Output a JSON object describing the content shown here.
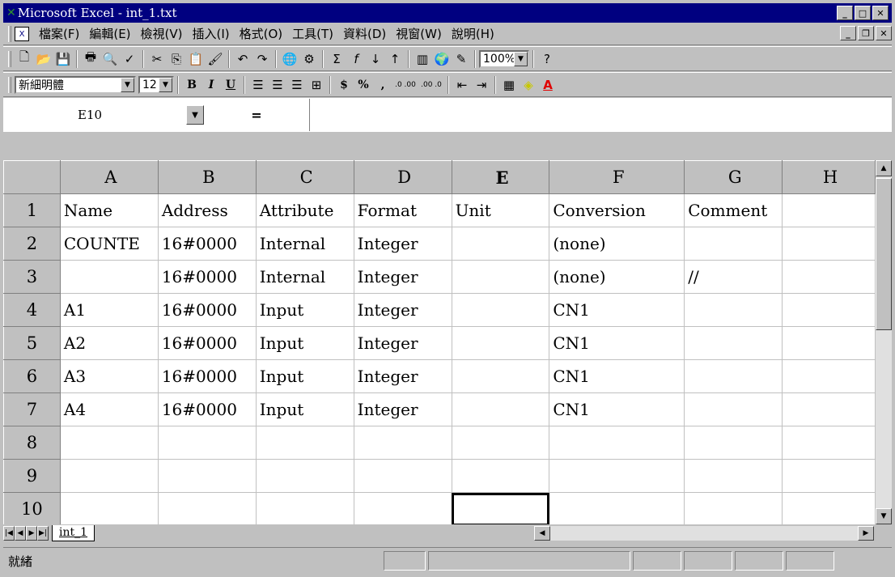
{
  "window": {
    "title": "Microsoft Excel - int_1.txt",
    "app_icon": "excel-icon",
    "buttons": [
      "minimize-icon",
      "restore-icon",
      "close-icon"
    ]
  },
  "menubar": {
    "items": [
      "檔案(F)",
      "編輯(E)",
      "檢視(V)",
      "插入(I)",
      "格式(O)",
      "工具(T)",
      "資料(D)",
      "視窗(W)",
      "說明(H)"
    ]
  },
  "toolbar": {
    "zoom": "100%",
    "icons": [
      "new-icon",
      "open-icon",
      "save-icon",
      "print-icon",
      "print-preview-icon",
      "spelling-icon",
      "cut-icon",
      "copy-icon",
      "paste-icon",
      "format-painter-icon",
      "undo-icon",
      "redo-icon",
      "hyperlink-icon",
      "web-icon",
      "autosum-icon",
      "function-icon",
      "sort-asc-icon",
      "sort-desc-icon",
      "chart-wizard-icon",
      "map-icon",
      "drawing-icon",
      "help-icon"
    ]
  },
  "format": {
    "font": "新細明體",
    "size": "12",
    "bold": "B",
    "italic": "I",
    "underline": "U",
    "currency": "$",
    "percent": "%",
    "comma": ",",
    "inc_decimal": ".0 .00",
    "dec_decimal": ".00 .0"
  },
  "formula": {
    "namebox": "E10",
    "equals": "="
  },
  "columns": [
    "A",
    "B",
    "C",
    "D",
    "E",
    "F",
    "G",
    "H"
  ],
  "active_column": "E",
  "rows": [
    {
      "n": "1",
      "cells": [
        "Name",
        "Address",
        "Attribute",
        "Format",
        "Unit",
        "Conversion",
        "Comment",
        ""
      ]
    },
    {
      "n": "2",
      "cells": [
        "COUNTE",
        "16#0000",
        "Internal",
        "Integer",
        "",
        "(none)",
        "",
        ""
      ]
    },
    {
      "n": "3",
      "cells": [
        "",
        "16#0000",
        "Internal",
        "Integer",
        "",
        "(none)",
        "//",
        ""
      ]
    },
    {
      "n": "4",
      "cells": [
        "A1",
        "16#0000",
        "Input",
        "Integer",
        "",
        "CN1",
        "",
        ""
      ]
    },
    {
      "n": "5",
      "cells": [
        "A2",
        "16#0000",
        "Input",
        "Integer",
        "",
        "CN1",
        "",
        ""
      ]
    },
    {
      "n": "6",
      "cells": [
        "A3",
        "16#0000",
        "Input",
        "Integer",
        "",
        "CN1",
        "",
        ""
      ]
    },
    {
      "n": "7",
      "cells": [
        "A4",
        "16#0000",
        "Input",
        "Integer",
        "",
        "CN1",
        "",
        ""
      ]
    },
    {
      "n": "8",
      "cells": [
        "",
        "",
        "",
        "",
        "",
        "",
        "",
        ""
      ]
    },
    {
      "n": "9",
      "cells": [
        "",
        "",
        "",
        "",
        "",
        "",
        "",
        ""
      ]
    },
    {
      "n": "10",
      "cells": [
        "",
        "",
        "",
        "",
        "",
        "",
        "",
        ""
      ]
    }
  ],
  "selected_cell": "E10",
  "sheet_tab": "int_1",
  "status": "就緒"
}
